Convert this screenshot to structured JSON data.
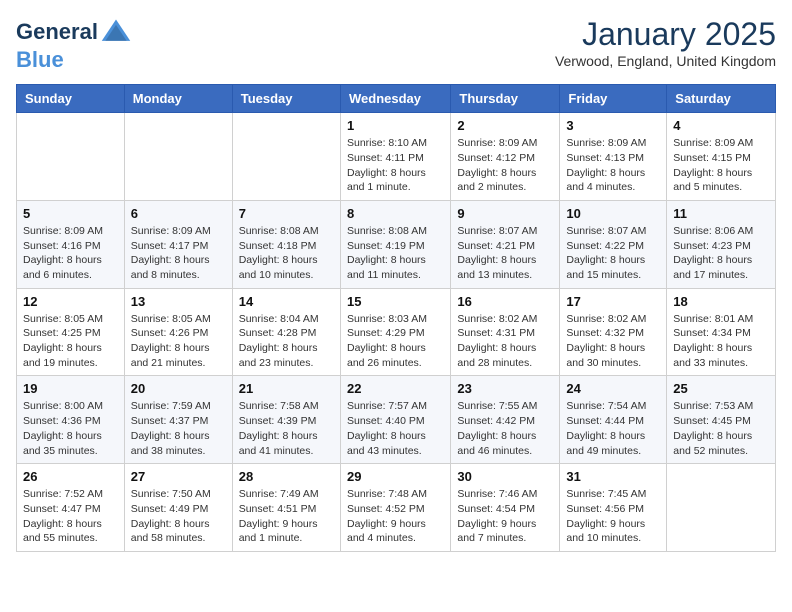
{
  "header": {
    "logo_line1": "General",
    "logo_line2": "Blue",
    "month_title": "January 2025",
    "location": "Verwood, England, United Kingdom"
  },
  "weekdays": [
    "Sunday",
    "Monday",
    "Tuesday",
    "Wednesday",
    "Thursday",
    "Friday",
    "Saturday"
  ],
  "weeks": [
    [
      {
        "day": "",
        "info": ""
      },
      {
        "day": "",
        "info": ""
      },
      {
        "day": "",
        "info": ""
      },
      {
        "day": "1",
        "info": "Sunrise: 8:10 AM\nSunset: 4:11 PM\nDaylight: 8 hours and 1 minute."
      },
      {
        "day": "2",
        "info": "Sunrise: 8:09 AM\nSunset: 4:12 PM\nDaylight: 8 hours and 2 minutes."
      },
      {
        "day": "3",
        "info": "Sunrise: 8:09 AM\nSunset: 4:13 PM\nDaylight: 8 hours and 4 minutes."
      },
      {
        "day": "4",
        "info": "Sunrise: 8:09 AM\nSunset: 4:15 PM\nDaylight: 8 hours and 5 minutes."
      }
    ],
    [
      {
        "day": "5",
        "info": "Sunrise: 8:09 AM\nSunset: 4:16 PM\nDaylight: 8 hours and 6 minutes."
      },
      {
        "day": "6",
        "info": "Sunrise: 8:09 AM\nSunset: 4:17 PM\nDaylight: 8 hours and 8 minutes."
      },
      {
        "day": "7",
        "info": "Sunrise: 8:08 AM\nSunset: 4:18 PM\nDaylight: 8 hours and 10 minutes."
      },
      {
        "day": "8",
        "info": "Sunrise: 8:08 AM\nSunset: 4:19 PM\nDaylight: 8 hours and 11 minutes."
      },
      {
        "day": "9",
        "info": "Sunrise: 8:07 AM\nSunset: 4:21 PM\nDaylight: 8 hours and 13 minutes."
      },
      {
        "day": "10",
        "info": "Sunrise: 8:07 AM\nSunset: 4:22 PM\nDaylight: 8 hours and 15 minutes."
      },
      {
        "day": "11",
        "info": "Sunrise: 8:06 AM\nSunset: 4:23 PM\nDaylight: 8 hours and 17 minutes."
      }
    ],
    [
      {
        "day": "12",
        "info": "Sunrise: 8:05 AM\nSunset: 4:25 PM\nDaylight: 8 hours and 19 minutes."
      },
      {
        "day": "13",
        "info": "Sunrise: 8:05 AM\nSunset: 4:26 PM\nDaylight: 8 hours and 21 minutes."
      },
      {
        "day": "14",
        "info": "Sunrise: 8:04 AM\nSunset: 4:28 PM\nDaylight: 8 hours and 23 minutes."
      },
      {
        "day": "15",
        "info": "Sunrise: 8:03 AM\nSunset: 4:29 PM\nDaylight: 8 hours and 26 minutes."
      },
      {
        "day": "16",
        "info": "Sunrise: 8:02 AM\nSunset: 4:31 PM\nDaylight: 8 hours and 28 minutes."
      },
      {
        "day": "17",
        "info": "Sunrise: 8:02 AM\nSunset: 4:32 PM\nDaylight: 8 hours and 30 minutes."
      },
      {
        "day": "18",
        "info": "Sunrise: 8:01 AM\nSunset: 4:34 PM\nDaylight: 8 hours and 33 minutes."
      }
    ],
    [
      {
        "day": "19",
        "info": "Sunrise: 8:00 AM\nSunset: 4:36 PM\nDaylight: 8 hours and 35 minutes."
      },
      {
        "day": "20",
        "info": "Sunrise: 7:59 AM\nSunset: 4:37 PM\nDaylight: 8 hours and 38 minutes."
      },
      {
        "day": "21",
        "info": "Sunrise: 7:58 AM\nSunset: 4:39 PM\nDaylight: 8 hours and 41 minutes."
      },
      {
        "day": "22",
        "info": "Sunrise: 7:57 AM\nSunset: 4:40 PM\nDaylight: 8 hours and 43 minutes."
      },
      {
        "day": "23",
        "info": "Sunrise: 7:55 AM\nSunset: 4:42 PM\nDaylight: 8 hours and 46 minutes."
      },
      {
        "day": "24",
        "info": "Sunrise: 7:54 AM\nSunset: 4:44 PM\nDaylight: 8 hours and 49 minutes."
      },
      {
        "day": "25",
        "info": "Sunrise: 7:53 AM\nSunset: 4:45 PM\nDaylight: 8 hours and 52 minutes."
      }
    ],
    [
      {
        "day": "26",
        "info": "Sunrise: 7:52 AM\nSunset: 4:47 PM\nDaylight: 8 hours and 55 minutes."
      },
      {
        "day": "27",
        "info": "Sunrise: 7:50 AM\nSunset: 4:49 PM\nDaylight: 8 hours and 58 minutes."
      },
      {
        "day": "28",
        "info": "Sunrise: 7:49 AM\nSunset: 4:51 PM\nDaylight: 9 hours and 1 minute."
      },
      {
        "day": "29",
        "info": "Sunrise: 7:48 AM\nSunset: 4:52 PM\nDaylight: 9 hours and 4 minutes."
      },
      {
        "day": "30",
        "info": "Sunrise: 7:46 AM\nSunset: 4:54 PM\nDaylight: 9 hours and 7 minutes."
      },
      {
        "day": "31",
        "info": "Sunrise: 7:45 AM\nSunset: 4:56 PM\nDaylight: 9 hours and 10 minutes."
      },
      {
        "day": "",
        "info": ""
      }
    ]
  ]
}
